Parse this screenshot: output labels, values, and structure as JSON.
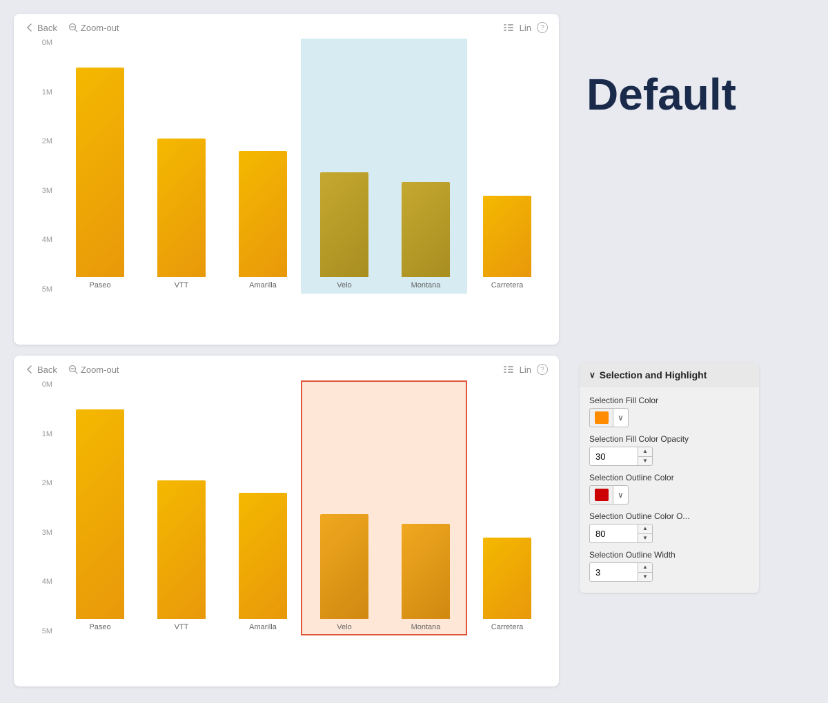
{
  "charts": {
    "top": {
      "toolbar": {
        "back_label": "Back",
        "zoomout_label": "Zoom-out",
        "legend_label": "Lin"
      },
      "y_labels": [
        "0M",
        "1M",
        "2M",
        "3M",
        "4M",
        "5M"
      ],
      "bars": [
        {
          "label": "Paseo",
          "height_pct": 88,
          "color": "#f0a800"
        },
        {
          "label": "VTT",
          "height_pct": 58,
          "color": "#f0a800"
        },
        {
          "label": "Amarilla",
          "height_pct": 53,
          "color": "#f0a800"
        },
        {
          "label": "Velo",
          "height_pct": 44,
          "color": "#b0a040",
          "selected": true
        },
        {
          "label": "Montana",
          "height_pct": 40,
          "color": "#b0a040",
          "selected": true
        },
        {
          "label": "Carretera",
          "height_pct": 34,
          "color": "#f0a800"
        }
      ],
      "selection": {
        "start_pct": 50,
        "width_pct": 33.5,
        "fill": "rgba(173, 216, 230, 0.5)",
        "outline": "none"
      }
    },
    "bottom": {
      "toolbar": {
        "back_label": "Back",
        "zoomout_label": "Zoom-out",
        "legend_label": "Lin"
      },
      "y_labels": [
        "0M",
        "1M",
        "2M",
        "3M",
        "4M",
        "5M"
      ],
      "bars": [
        {
          "label": "Paseo",
          "height_pct": 88,
          "color": "#f0a800"
        },
        {
          "label": "VTT",
          "height_pct": 58,
          "color": "#f0a800"
        },
        {
          "label": "Amarilla",
          "height_pct": 53,
          "color": "#f0a800"
        },
        {
          "label": "Velo",
          "height_pct": 44,
          "color": "#e8981a",
          "selected": true
        },
        {
          "label": "Montana",
          "height_pct": 40,
          "color": "#e8981a",
          "selected": true
        },
        {
          "label": "Carretera",
          "height_pct": 34,
          "color": "#f0a800"
        }
      ],
      "selection": {
        "fill": "rgba(255, 160, 122, 0.3)",
        "outline_color": "rgba(220, 60, 30, 0.9)",
        "outline_width": 2
      }
    }
  },
  "default_label": "Default",
  "settings": {
    "section_title": "Selection and Highlight",
    "fill_color_label": "Selection Fill Color",
    "fill_color_value": "#ff8c00",
    "fill_opacity_label": "Selection Fill Color Opacity",
    "fill_opacity_value": "30",
    "outline_color_label": "Selection Outline Color",
    "outline_color_value": "#cc0000",
    "outline_opacity_label": "Selection Outline Color O...",
    "outline_opacity_value": "80",
    "outline_width_label": "Selection Outline Width",
    "outline_width_value": "3",
    "chevron": "∨"
  }
}
